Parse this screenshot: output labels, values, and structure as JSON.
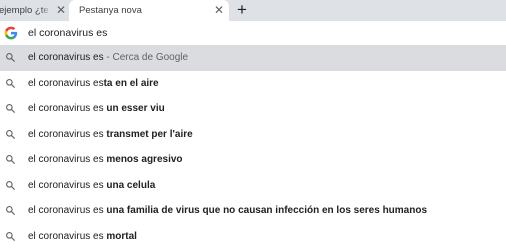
{
  "tabs": [
    {
      "title": "ejemplo ¿te co"
    },
    {
      "title": "Pestanya nova"
    }
  ],
  "omnibox": {
    "value": "el coronavirus es"
  },
  "suggestions": [
    {
      "prefix": "el coronavirus es",
      "bold": "",
      "suffix": " - Cerca de Google"
    },
    {
      "prefix": "el coronavirus es",
      "bold": "ta en el aire",
      "suffix": ""
    },
    {
      "prefix": "el coronavirus es ",
      "bold": "un esser viu",
      "suffix": ""
    },
    {
      "prefix": "el coronavirus es ",
      "bold": "transmet per l'aire",
      "suffix": ""
    },
    {
      "prefix": "el coronavirus es ",
      "bold": "menos agresivo",
      "suffix": ""
    },
    {
      "prefix": "el coronavirus es ",
      "bold": "una celula",
      "suffix": ""
    },
    {
      "prefix": "el coronavirus es ",
      "bold": "una familia de virus que no causan infección en los seres humanos",
      "suffix": ""
    },
    {
      "prefix": "el coronavirus es ",
      "bold": "mortal",
      "suffix": ""
    }
  ],
  "icons": {
    "close": "close-icon",
    "new_tab": "plus-icon",
    "google": "google-g-icon",
    "search": "search-icon"
  },
  "colors": {
    "tabstrip": "#dee1e6",
    "selected_row": "#dadce0",
    "text": "#202124",
    "secondary_text": "#5f6368"
  }
}
